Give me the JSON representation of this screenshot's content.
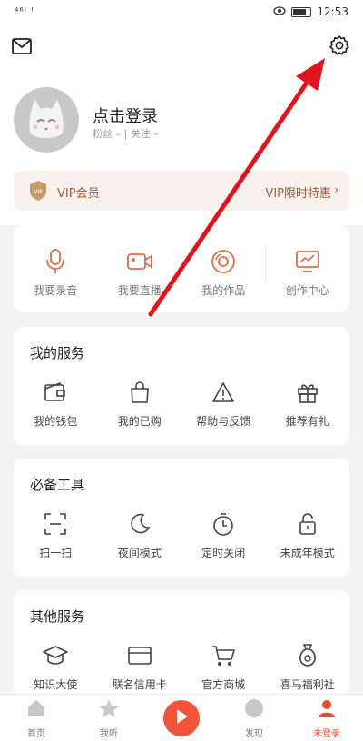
{
  "status_bar": {
    "signal": "⁴⁶ᴵ ᴵ ",
    "time": "12:53"
  },
  "header": {
    "mail_icon": "mail-icon",
    "settings_icon": "gear-icon"
  },
  "profile": {
    "login_title": "点击登录",
    "meta": "粉丝 –  |  关注 –"
  },
  "vip": {
    "badge": "VIP",
    "label": "VIP会员",
    "promo": "VIP限时特惠"
  },
  "create": {
    "items": [
      {
        "label": "我要录音",
        "icon": "microphone-icon"
      },
      {
        "label": "我要直播",
        "icon": "video-camera-icon"
      },
      {
        "label": "我的作品",
        "icon": "disc-icon"
      },
      {
        "label": "创作中心",
        "icon": "monitor-icon"
      }
    ]
  },
  "my_services": {
    "title": "我的服务",
    "items": [
      {
        "label": "我的钱包",
        "icon": "wallet-icon"
      },
      {
        "label": "我的已购",
        "icon": "shopping-bag-icon"
      },
      {
        "label": "帮助与反馈",
        "icon": "warning-icon"
      },
      {
        "label": "推荐有礼",
        "icon": "gift-icon"
      }
    ]
  },
  "tools": {
    "title": "必备工具",
    "items": [
      {
        "label": "扫一扫",
        "icon": "scan-icon"
      },
      {
        "label": "夜间模式",
        "icon": "moon-icon"
      },
      {
        "label": "定时关闭",
        "icon": "timer-icon"
      },
      {
        "label": "未成年模式",
        "icon": "lock-icon"
      }
    ]
  },
  "other_services": {
    "title": "其他服务",
    "items": [
      {
        "label": "知识大使",
        "icon": "graduation-cap-icon"
      },
      {
        "label": "联名信用卡",
        "icon": "credit-card-icon"
      },
      {
        "label": "官方商城",
        "icon": "cart-icon"
      },
      {
        "label": "喜马福利社",
        "icon": "money-bag-icon"
      }
    ]
  },
  "tabbar": {
    "tabs": [
      {
        "label": "首页",
        "icon": "home-icon"
      },
      {
        "label": "我听",
        "icon": "star-icon"
      },
      {
        "label": "发现",
        "icon": "discover-icon"
      },
      {
        "label": "未登录",
        "icon": "user-icon"
      }
    ],
    "play_icon": "play-icon"
  },
  "colors": {
    "accent": "#ef4b2f",
    "vip_text": "#9a5a36",
    "vip_bg": "#fbf1ec",
    "annotation_arrow": "#e0141e"
  }
}
